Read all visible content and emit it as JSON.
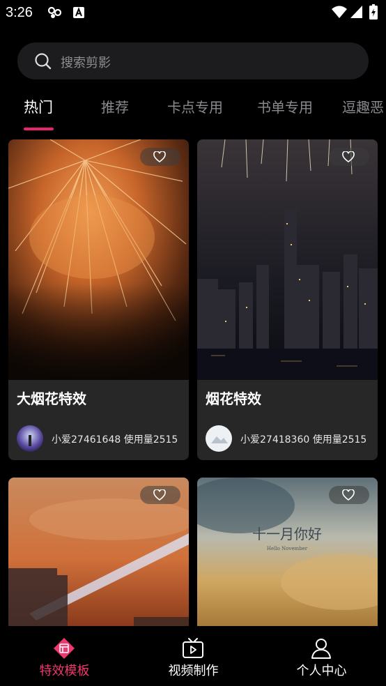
{
  "status_bar": {
    "time": "3:26",
    "left_icons": [
      "people-icon",
      "text-a-icon"
    ],
    "right_icons": [
      "wifi-icon",
      "signal-icon",
      "battery-icon"
    ]
  },
  "search": {
    "placeholder": "搜索剪影",
    "icon": "search-icon"
  },
  "tabs": [
    {
      "label": "热门",
      "active": true
    },
    {
      "label": "推荐",
      "active": false
    },
    {
      "label": "卡点专用",
      "active": false
    },
    {
      "label": "书单专用",
      "active": false
    },
    {
      "label": "逗趣恶",
      "active": false
    }
  ],
  "cards": [
    {
      "title": "大烟花特效",
      "author": "小爱27461648",
      "usage": "使用量2515",
      "meta": "小爱27461648 使用量2515"
    },
    {
      "title": "烟花特效",
      "author": "小爱27418360",
      "usage": "使用量2515",
      "meta": "小爱27418360 使用量2515"
    },
    {
      "title": "",
      "meta": ""
    },
    {
      "title": "",
      "meta": "",
      "thumb_text": "十一月你好",
      "thumb_subtext": "Hello November"
    }
  ],
  "bottom_nav": [
    {
      "label": "特效模板",
      "icon": "template-icon",
      "active": true
    },
    {
      "label": "视频制作",
      "icon": "tv-icon",
      "active": false
    },
    {
      "label": "个人中心",
      "icon": "person-icon",
      "active": false
    }
  ],
  "colors": {
    "accent": "#e8246e",
    "active_nav": "#f0386f",
    "card_bg": "#272727",
    "search_bg": "#1c1c1e"
  }
}
